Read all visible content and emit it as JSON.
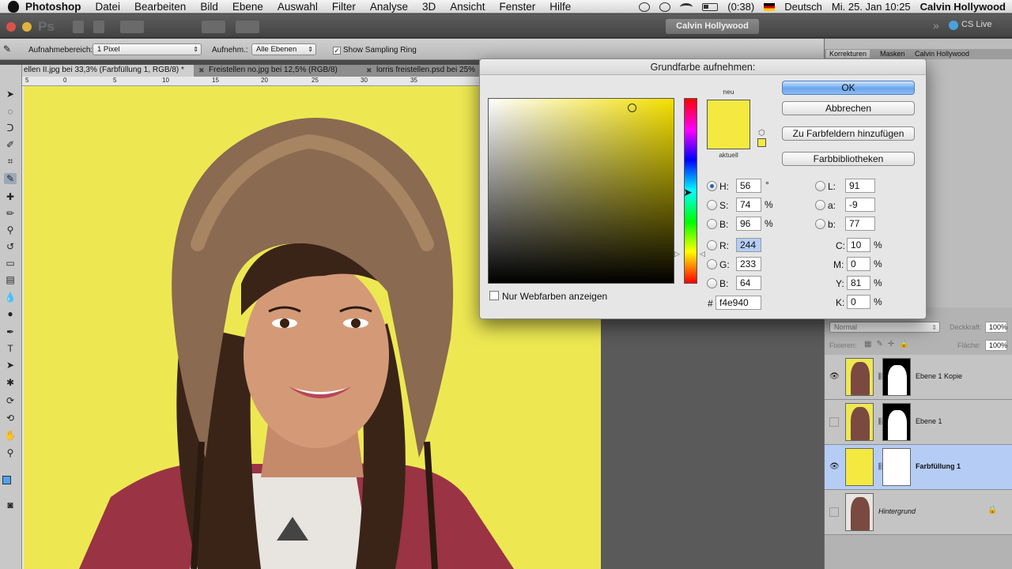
{
  "menubar": {
    "app": "Photoshop",
    "items": [
      "Datei",
      "Bearbeiten",
      "Bild",
      "Ebene",
      "Auswahl",
      "Filter",
      "Analyse",
      "3D",
      "Ansicht",
      "Fenster",
      "Hilfe"
    ],
    "battery": "(0:38)",
    "language": "Deutsch",
    "datetime": "Mi. 25. Jan 10:25",
    "user": "Calvin Hollywood"
  },
  "appbar": {
    "logo": "Ps",
    "workspace": "Calvin Hollywood",
    "cslive": "CS Live"
  },
  "options": {
    "sample_size_label": "Aufnahmebereich:",
    "sample_size_value": "1 Pixel",
    "sample_label": "Aufnehm.:",
    "sample_value": "Alle Ebenen",
    "ring_label": "Show Sampling Ring",
    "ring_checked": true
  },
  "tabs": [
    {
      "label": "ellen II.jpg bei 33,3% (Farbfüllung 1, RGB/8) *",
      "active": true
    },
    {
      "label": "Freistellen no.jpg bei 12,5% (RGB/8)",
      "active": false
    },
    {
      "label": "lorris freistellen.psd bei 25%",
      "active": false
    }
  ],
  "ruler_labels": [
    "5",
    "0",
    "5",
    "10",
    "15",
    "20",
    "25",
    "30",
    "35"
  ],
  "panel_tabs": [
    "Korrekturen",
    "Masken",
    "Calvin Hollywood"
  ],
  "layers_panel": {
    "blend_mode": "Normal",
    "opacity_label": "Deckkraft:",
    "opacity": "100%",
    "lock_label": "Fixieren:",
    "fill_label": "Fläche:",
    "fill": "100%",
    "layers": [
      {
        "name": "Ebene 1 Kopie",
        "visible": true,
        "selected": false
      },
      {
        "name": "Ebene 1",
        "visible": false,
        "selected": false
      },
      {
        "name": "Farbfüllung 1",
        "visible": true,
        "selected": true
      },
      {
        "name": "Hintergrund",
        "visible": false,
        "selected": false,
        "locked": true
      }
    ]
  },
  "dialog": {
    "title": "Grundfarbe aufnehmen:",
    "label_new": "neu",
    "label_current": "aktuell",
    "new_color": "#f4e940",
    "current_color": "#f4e940",
    "buttons": {
      "ok": "OK",
      "cancel": "Abbrechen",
      "add_swatch": "Zu Farbfeldern hinzufügen",
      "libraries": "Farbbibliotheken"
    },
    "hsb": {
      "H": "56",
      "S": "74",
      "B": "96"
    },
    "rgb": {
      "R": "244",
      "G": "233",
      "B": "64"
    },
    "lab": {
      "L": "91",
      "a": "-9",
      "b": "77"
    },
    "cmyk": {
      "C": "10",
      "M": "0",
      "Y": "81",
      "K": "0"
    },
    "hex_label": "#",
    "hex": "f4e940",
    "units": {
      "degree": "°",
      "percent": "%"
    },
    "web_only_label": "Nur Webfarben anzeigen"
  }
}
